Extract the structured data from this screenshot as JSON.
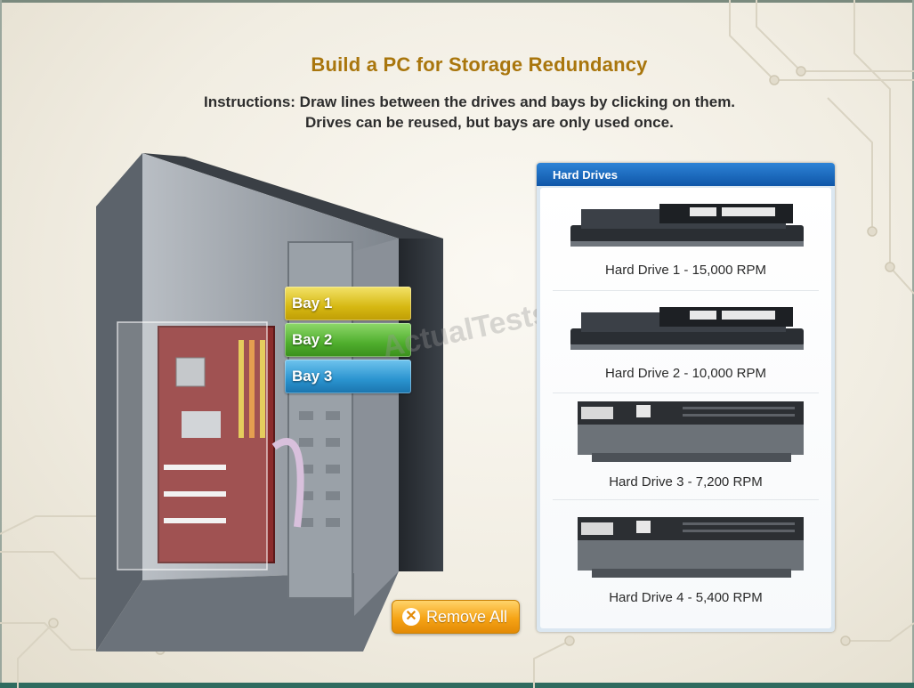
{
  "page": {
    "title": "Build a PC for Storage Redundancy",
    "instructions_line1": "Instructions: Draw lines between the drives and bays by clicking on them.",
    "instructions_line2": "Drives can be reused, but bays are only used once."
  },
  "bays": [
    {
      "label": "Bay 1",
      "color": "#d6b812"
    },
    {
      "label": "Bay 2",
      "color": "#4fae2d"
    },
    {
      "label": "Bay 3",
      "color": "#2a93cf"
    }
  ],
  "watermark": "ActualTests",
  "remove_button": {
    "label": "Remove All",
    "icon": "close-circle-icon"
  },
  "drives_panel": {
    "title": "Hard Drives",
    "items": [
      {
        "label": "Hard Drive 1 - 15,000 RPM",
        "icon": "sata-drive-icon"
      },
      {
        "label": "Hard Drive 2 - 10,000 RPM",
        "icon": "sata-drive-icon"
      },
      {
        "label": "Hard Drive 3 - 7,200 RPM",
        "icon": "ide-drive-icon"
      },
      {
        "label": "Hard Drive 4 - 5,400 RPM",
        "icon": "ide-drive-icon"
      }
    ]
  },
  "colors": {
    "title": "#a9760d",
    "panel_header": "#1a6cc0",
    "button": "#f6a416"
  }
}
